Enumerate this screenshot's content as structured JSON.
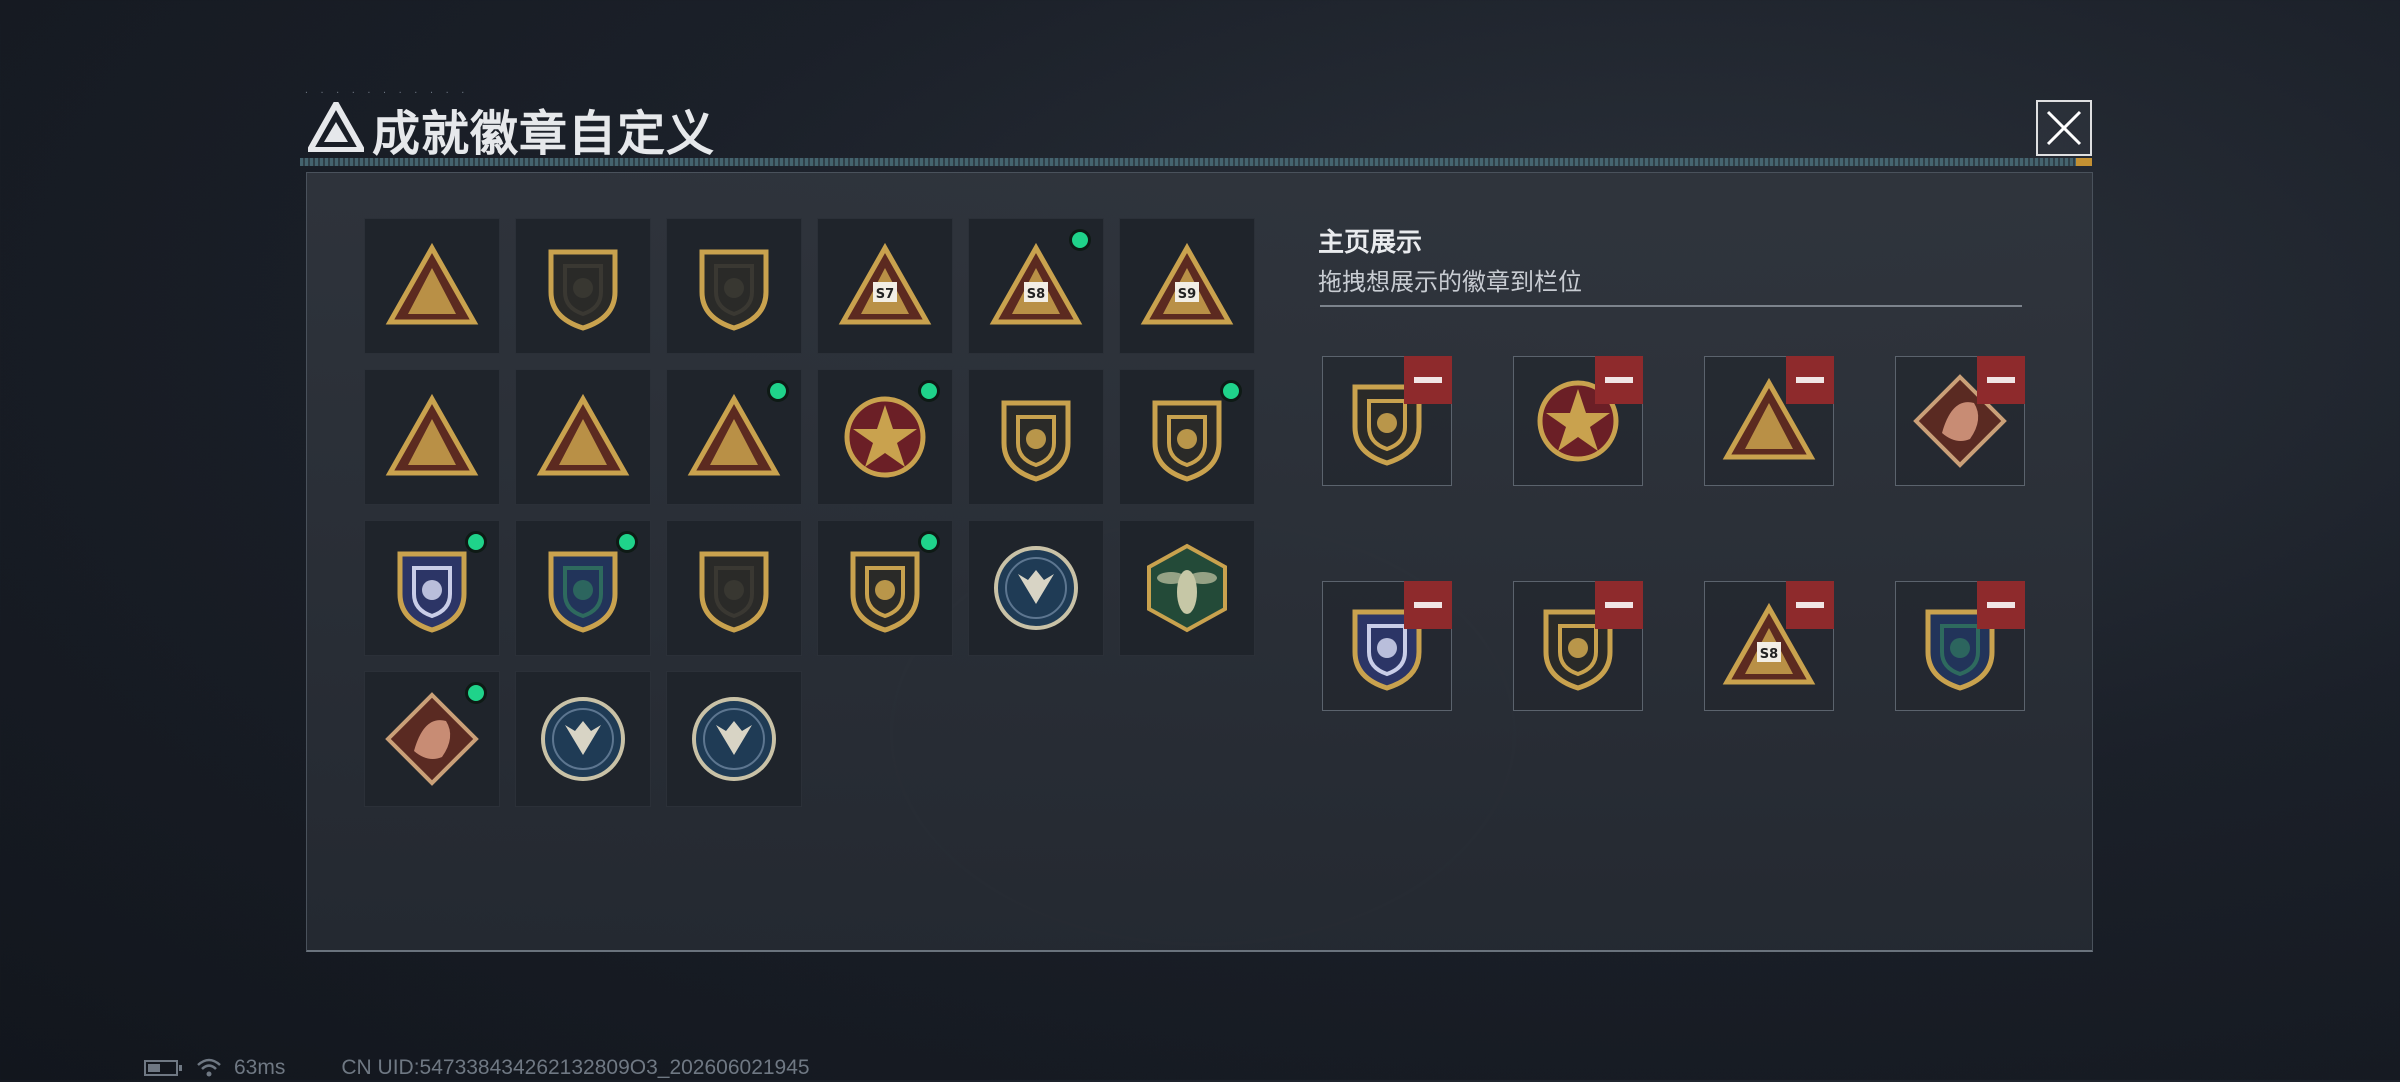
{
  "window": {
    "title": "成就徽章自定义",
    "title_tiny": "· · · · · · · · · · ·",
    "icons": {
      "logo": "triangle-logo-icon",
      "close": "close-icon"
    }
  },
  "badge_grid": {
    "rows": [
      [
        {
          "icon": "triangle-shield-badge",
          "new": false
        },
        {
          "icon": "helicopter-shield-badge",
          "new": false
        },
        {
          "icon": "diamond-shield-badge",
          "new": false
        },
        {
          "icon": "s7-triangle-badge",
          "label": "S7",
          "new": false
        },
        {
          "icon": "s8-triangle-badge",
          "label": "S8",
          "new": true
        },
        {
          "icon": "s9-triangle-badge",
          "label": "S9",
          "new": false
        }
      ],
      [
        {
          "icon": "soldier-triangle-badge",
          "new": false
        },
        {
          "icon": "boat-triangle-badge",
          "new": false
        },
        {
          "icon": "squad-triangle-badge",
          "new": true
        },
        {
          "icon": "star-medal-badge",
          "new": true
        },
        {
          "icon": "emblem-shield-badge",
          "new": false
        },
        {
          "icon": "laurel-shield-badge",
          "new": true
        }
      ],
      [
        {
          "icon": "crystal-shield-badge",
          "new": true
        },
        {
          "icon": "crosshair-shield-badge",
          "new": true
        },
        {
          "icon": "rifle-shield-badge",
          "new": false
        },
        {
          "icon": "crossed-guns-badge",
          "new": true
        },
        {
          "icon": "eagle-round-badge",
          "new": false
        },
        {
          "icon": "wasp-hex-badge",
          "new": false
        }
      ],
      [
        {
          "icon": "dragon-diamond-badge",
          "new": true
        },
        {
          "icon": "lynx-round-badge",
          "new": false
        },
        {
          "icon": "lynx-round-badge-2",
          "new": false
        }
      ]
    ]
  },
  "showcase": {
    "title": "主页展示",
    "subtitle": "拖拽想展示的徽章到栏位",
    "remove_icon": "minus-icon",
    "slots": [
      {
        "icon": "laurel-shield-badge"
      },
      {
        "icon": "star-medal-badge"
      },
      {
        "icon": "squad-triangle-badge"
      },
      {
        "icon": "dragon-diamond-badge"
      },
      {
        "icon": "crystal-shield-badge"
      },
      {
        "icon": "crossed-guns-badge"
      },
      {
        "icon": "s8-triangle-badge",
        "label": "S8"
      },
      {
        "icon": "crosshair-shield-badge"
      }
    ]
  },
  "footer": {
    "ping": "63ms",
    "uid": "CN UID:547338434262132809O3_202606021945"
  },
  "colors": {
    "gold": "#c9a24e",
    "accent_green": "#1fd38a",
    "remove_red": "#8e2a2c",
    "progress_orange": "#e1a434"
  }
}
